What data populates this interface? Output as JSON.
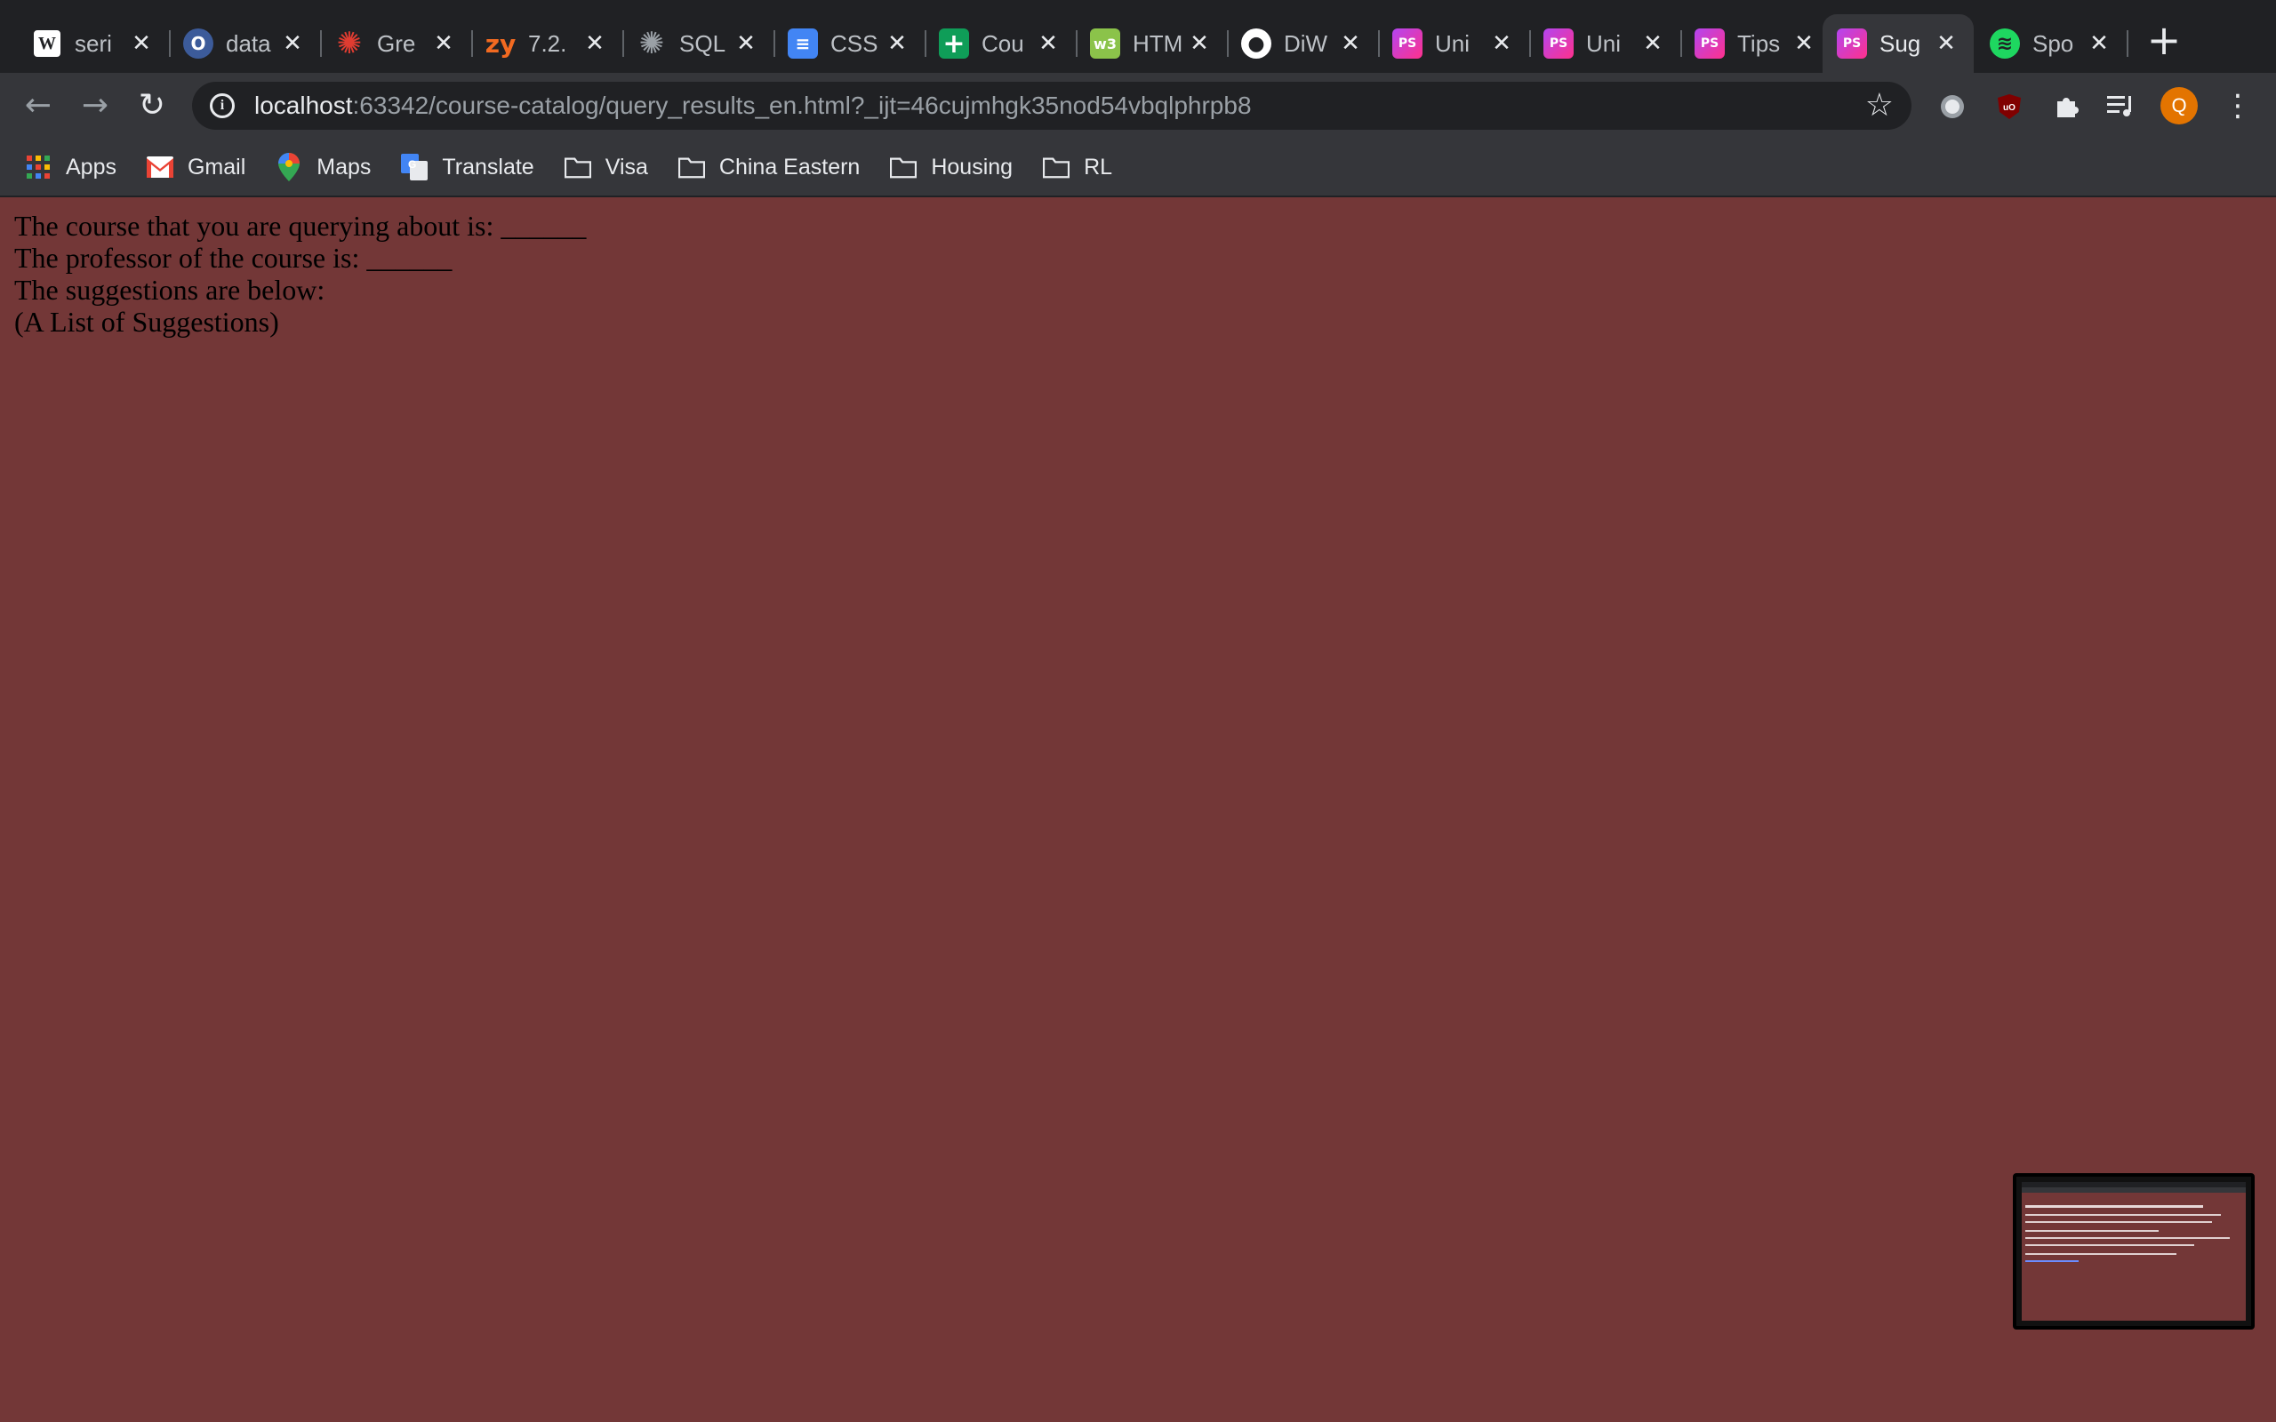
{
  "tabs": [
    {
      "title": "seri",
      "favicon": "wiki-w-icon",
      "fav_text": "W",
      "fav_color": "#ffffff"
    },
    {
      "title": "data",
      "favicon": "o-icon",
      "fav_text": "O",
      "fav_color": "#3c5b9a"
    },
    {
      "title": "Gre",
      "favicon": "gear-red-icon",
      "fav_text": "✺",
      "fav_color": "#e03c31"
    },
    {
      "title": "7.2.",
      "favicon": "zy-icon",
      "fav_text": "zy",
      "fav_color": "#f26a21"
    },
    {
      "title": "SQL",
      "favicon": "sqlbolt-icon",
      "fav_text": "✺",
      "fav_color": "#9aa0a6"
    },
    {
      "title": "CSS",
      "favicon": "google-docs-icon",
      "fav_text": "≡",
      "fav_color": "#4285f4"
    },
    {
      "title": "Cou",
      "favicon": "google-sheets-icon",
      "fav_text": "+",
      "fav_color": "#0f9d58"
    },
    {
      "title": "HTM",
      "favicon": "w3-icon",
      "fav_text": "w3",
      "fav_color": "#8bc34a"
    },
    {
      "title": "DiW",
      "favicon": "github-icon",
      "fav_text": "●",
      "fav_color": "#ffffff"
    },
    {
      "title": "Uni",
      "favicon": "phpstorm-icon",
      "fav_text": "PS",
      "fav_color": "#b345f1"
    },
    {
      "title": "Uni",
      "favicon": "phpstorm-icon",
      "fav_text": "PS",
      "fav_color": "#b345f1"
    },
    {
      "title": "Tips",
      "favicon": "phpstorm-icon",
      "fav_text": "PS",
      "fav_color": "#b345f1"
    },
    {
      "title": "Sug",
      "favicon": "phpstorm-icon",
      "fav_text": "PS",
      "fav_color": "#b345f1",
      "active": true
    },
    {
      "title": "Spo",
      "favicon": "spotify-icon",
      "fav_text": "≋",
      "fav_color": "#1ed760"
    }
  ],
  "toolbar": {
    "back_icon": "←",
    "forward_icon": "→",
    "reload_icon": "↻",
    "url_host": "localhost",
    "url_path": ":63342/course-catalog/query_results_en.html?_ijt=46cujmhgk35nod54vbqlphrpb8",
    "bookmark_star_icon": "☆",
    "profile_initial": "Q",
    "menu_icon": "⋮"
  },
  "bookmarks": [
    {
      "label": "Apps",
      "icon": "apps-grid-icon"
    },
    {
      "label": "Gmail",
      "icon": "gmail-icon"
    },
    {
      "label": "Maps",
      "icon": "maps-pin-icon"
    },
    {
      "label": "Translate",
      "icon": "translate-icon"
    },
    {
      "label": "Visa",
      "icon": "folder-icon"
    },
    {
      "label": "China Eastern",
      "icon": "folder-icon"
    },
    {
      "label": "Housing",
      "icon": "folder-icon"
    },
    {
      "label": "RL",
      "icon": "folder-icon"
    }
  ],
  "page": {
    "background": "#733737",
    "lines": [
      "The course that you are querying about is: ______",
      "The professor of the course is: ______",
      "The suggestions are below:",
      "(A List of Suggestions)"
    ]
  }
}
